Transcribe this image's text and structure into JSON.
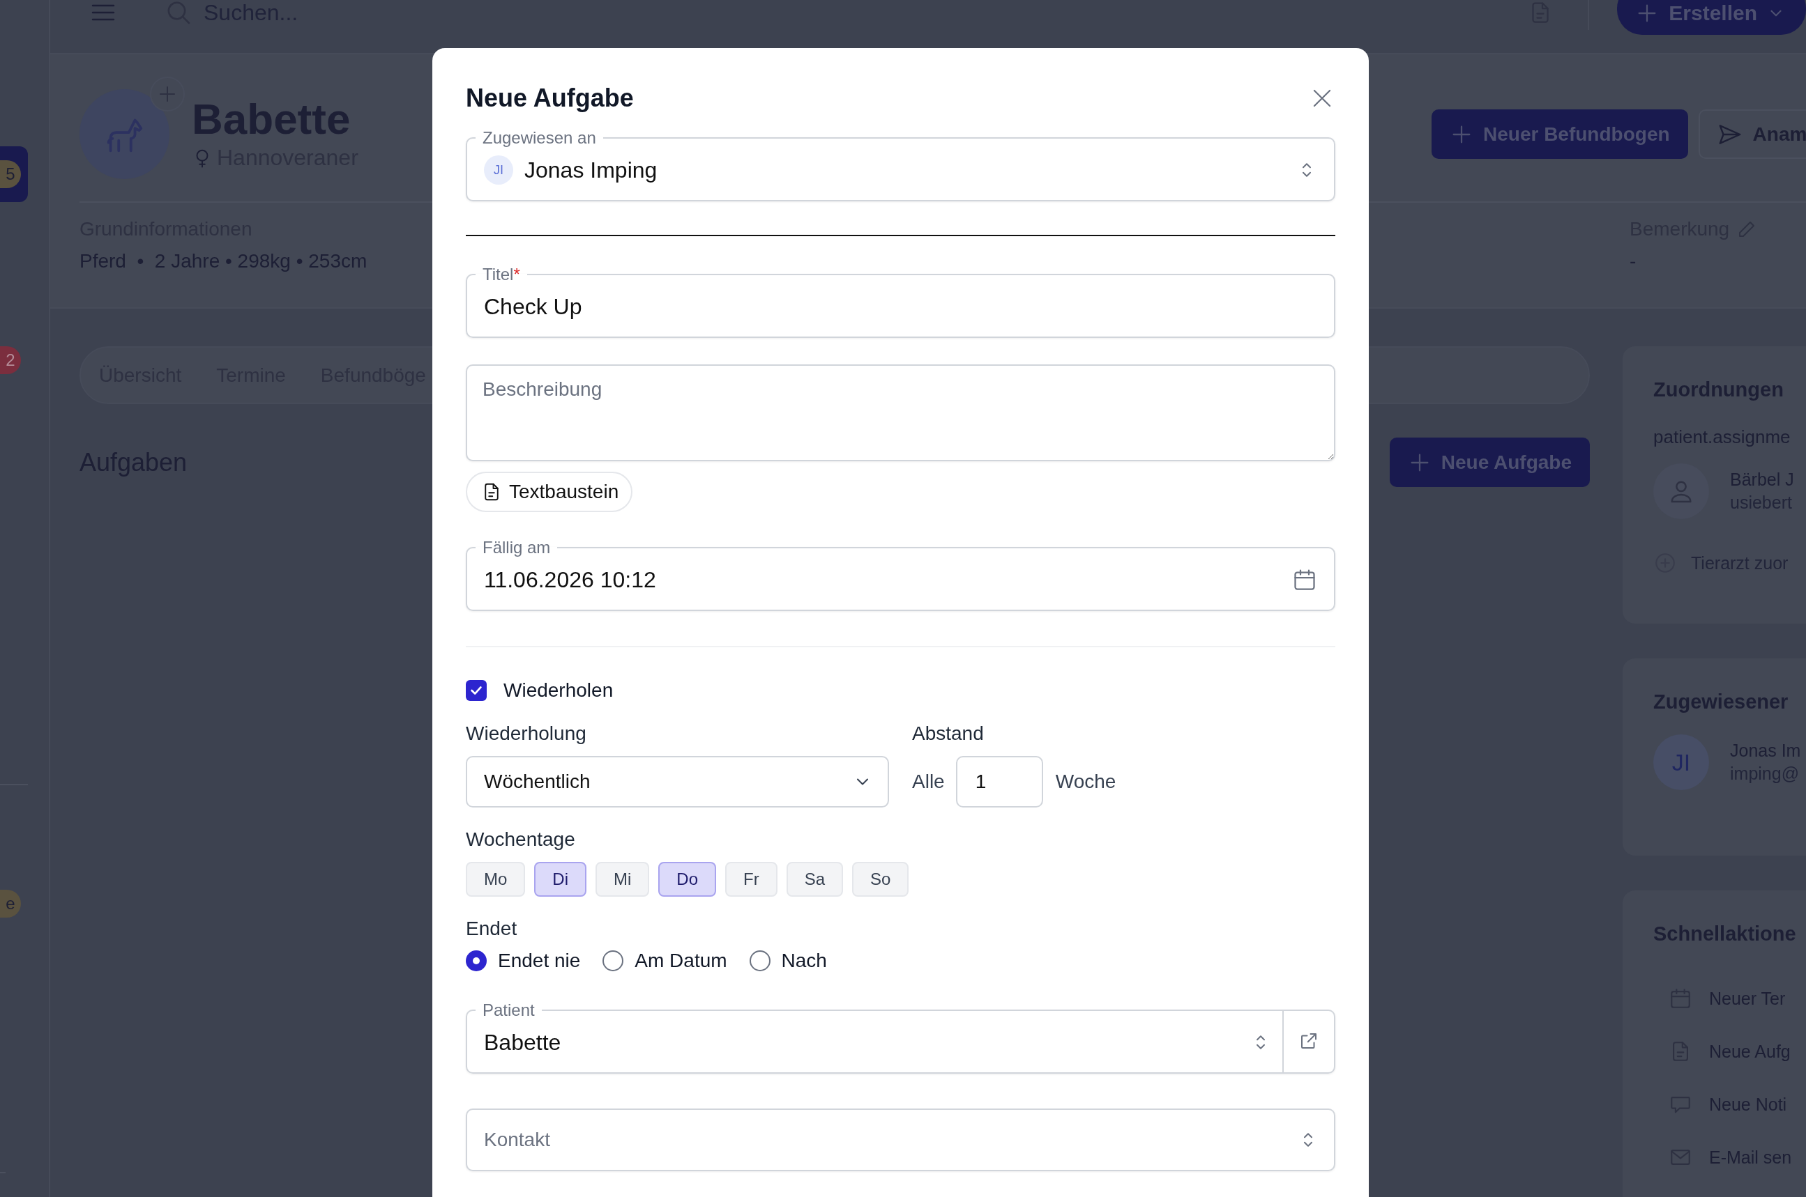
{
  "sidebar": {
    "badges": [
      {
        "text": "5",
        "color": "#5a523f"
      },
      {
        "text": "2",
        "color": "#7b2e3e"
      },
      {
        "text": "e",
        "color": "#5a523f"
      }
    ]
  },
  "topbar": {
    "search_placeholder": "Suchen...",
    "create_button": "Erstellen"
  },
  "patient": {
    "name": "Babette",
    "breed": "Hannoveraner",
    "info_label": "Grundinformationen",
    "info": "Pferd  •  2 Jahre • 298kg • 253cm",
    "actions": [
      "Neuer Befundbogen",
      "Anam"
    ],
    "remark_label": "Bemerkung",
    "remark": "-"
  },
  "tabs": [
    {
      "label": "Übersicht"
    },
    {
      "label": "Termine"
    },
    {
      "label": "Befundböge"
    }
  ],
  "tasks": {
    "title": "Aufgaben",
    "new_button": "Neue Aufgabe"
  },
  "assignments": {
    "title": "Zuordnungen",
    "subtitle": "patient.assignme",
    "person_name": "Bärbel J",
    "person_email": "usiebert",
    "add_link": "Tierarzt zuor"
  },
  "assigned": {
    "title": "Zugewiesener",
    "initials": "JI",
    "name": "Jonas Im",
    "email": "imping@"
  },
  "quick_actions": {
    "title": "Schnellaktione",
    "items": [
      {
        "kind": "calendar",
        "label": "Neuer Ter"
      },
      {
        "kind": "document",
        "label": "Neue Aufg"
      },
      {
        "kind": "chat",
        "label": "Neue Noti"
      },
      {
        "kind": "mail",
        "label": "E-Mail sen"
      }
    ]
  },
  "dialog": {
    "title": "Neue Aufgabe",
    "assignee": {
      "label": "Zugewiesen an",
      "initials": "JI",
      "value": "Jonas Imping"
    },
    "title_field": {
      "label": "Titel",
      "required_mark": "*",
      "value": "Check Up"
    },
    "description": {
      "placeholder": "Beschreibung"
    },
    "snippet_button": "Textbaustein",
    "due": {
      "label": "Fällig am",
      "value": "11.06.2026 10:12"
    },
    "repeat": {
      "label": "Wiederholen",
      "checked": true
    },
    "recurrence": {
      "label": "Wiederholung",
      "value": "Wöchentlich"
    },
    "interval": {
      "label": "Abstand",
      "prefix": "Alle",
      "value": "1",
      "unit": "Woche"
    },
    "weekdays": {
      "label": "Wochentage",
      "days": [
        {
          "label": "Mo",
          "selected": false
        },
        {
          "label": "Di",
          "selected": true
        },
        {
          "label": "Mi",
          "selected": false
        },
        {
          "label": "Do",
          "selected": true
        },
        {
          "label": "Fr",
          "selected": false
        },
        {
          "label": "Sa",
          "selected": false
        },
        {
          "label": "So",
          "selected": false
        }
      ]
    },
    "ends": {
      "label": "Endet",
      "options": [
        {
          "label": "Endet nie",
          "selected": true
        },
        {
          "label": "Am Datum",
          "selected": false
        },
        {
          "label": "Nach",
          "selected": false
        }
      ]
    },
    "patient": {
      "label": "Patient",
      "value": "Babette"
    },
    "contact": {
      "placeholder": "Kontakt"
    }
  }
}
